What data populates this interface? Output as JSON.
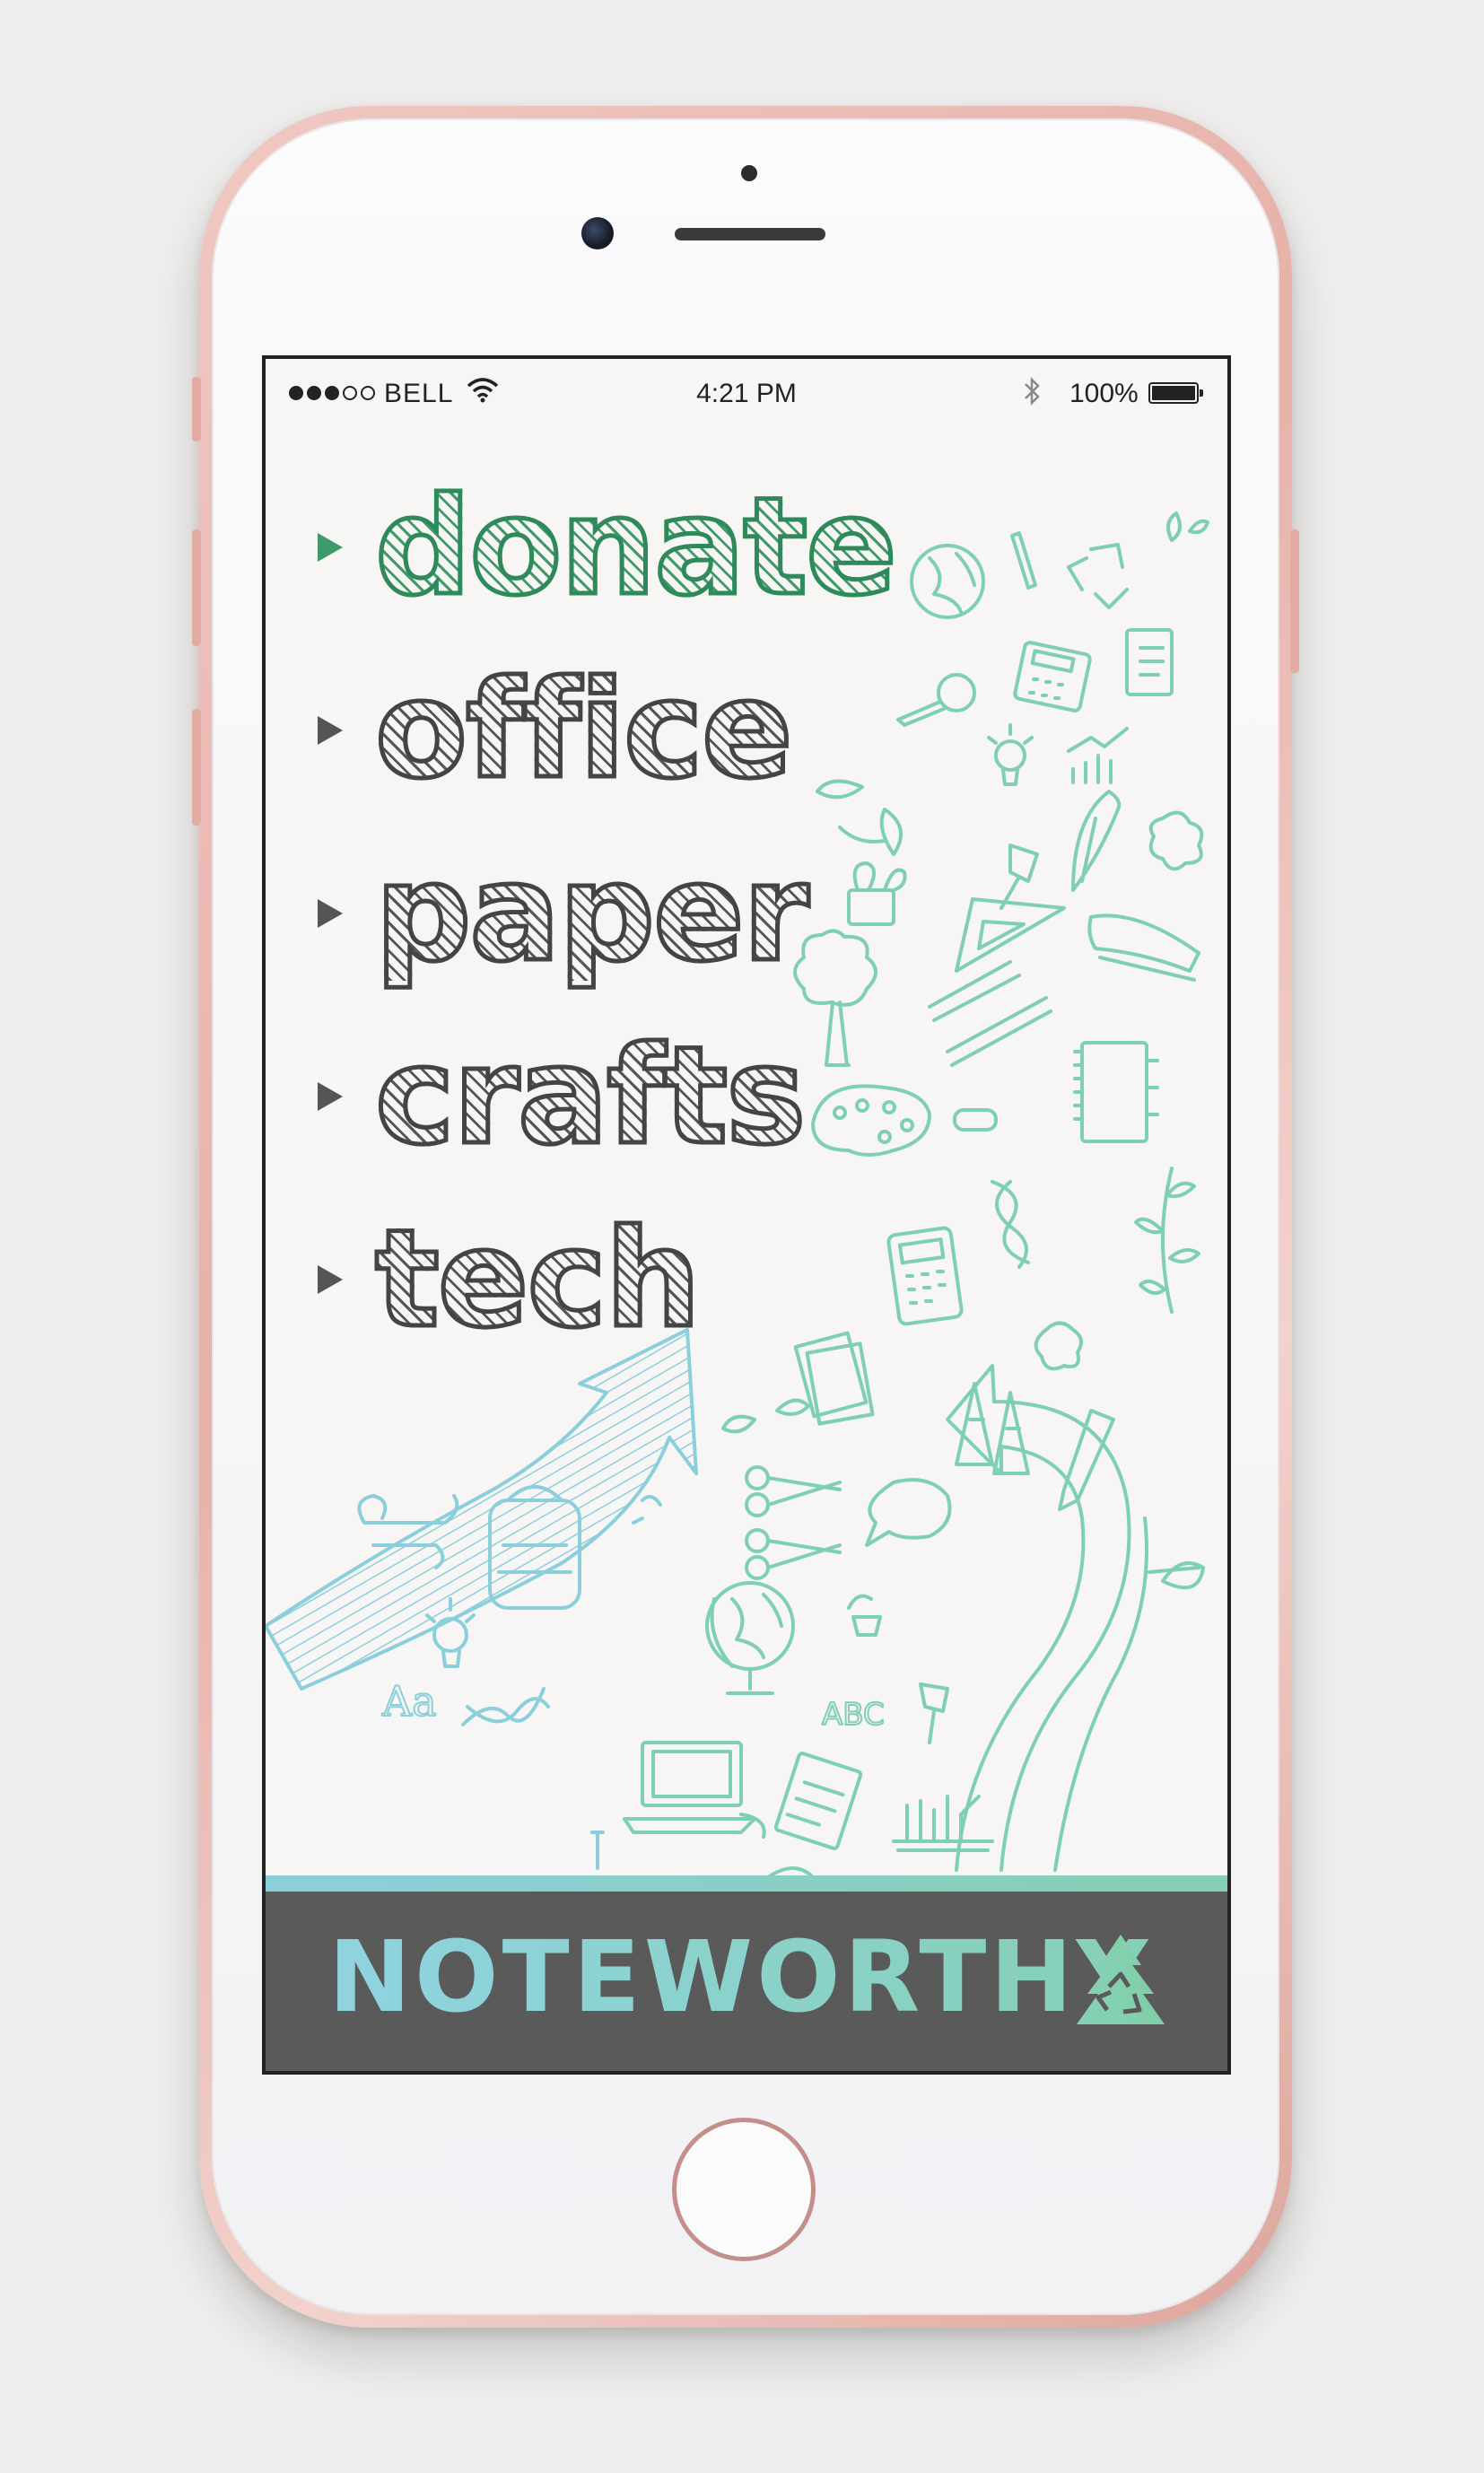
{
  "status_bar": {
    "signal_bars": 3,
    "signal_total": 5,
    "carrier": "BELL",
    "time": "4:21 PM",
    "battery": "100%",
    "battery_level": 1.0
  },
  "menu": {
    "items": [
      {
        "label": "donate",
        "active": true
      },
      {
        "label": "office",
        "active": false
      },
      {
        "label": "paper",
        "active": false
      },
      {
        "label": "crafts",
        "active": false
      },
      {
        "label": "tech",
        "active": false
      }
    ]
  },
  "footer": {
    "brand": "NOTEWORTHY",
    "logo_icon": "recycle-tree-icon"
  },
  "illustration": {
    "subject": "hand-drawn school and office supply doodles",
    "text_in_drawing": [
      "Aa",
      "ABC"
    ],
    "colors": {
      "teal": "#7fcfb5",
      "blue": "#8ccfdc"
    }
  },
  "colors": {
    "accent_green": "#3f9a6a",
    "menu_gray": "#444444",
    "footer_bg": "#5a5a5a",
    "phone_rose": "#e6b2aa"
  }
}
